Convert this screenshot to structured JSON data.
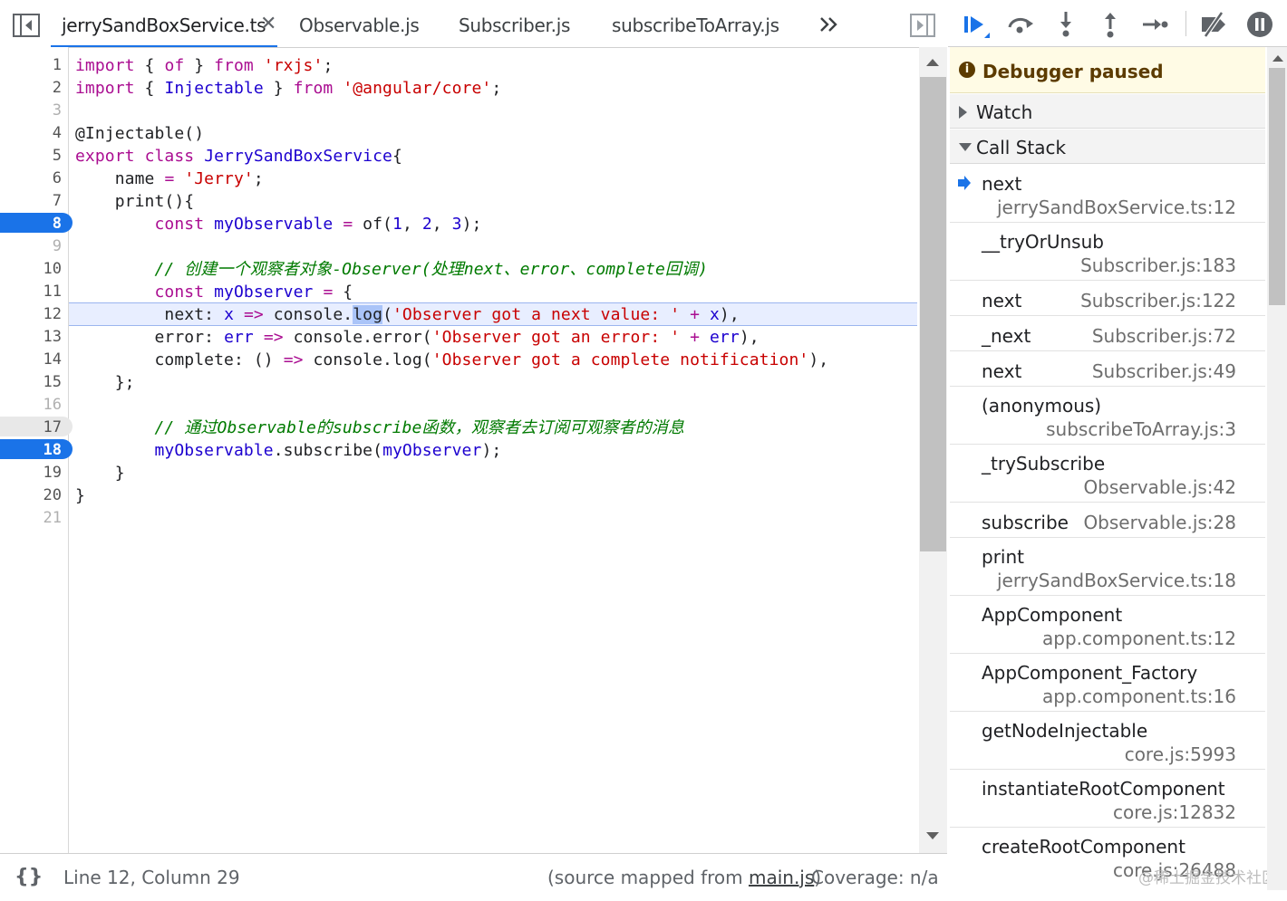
{
  "editor": {
    "tabs": [
      {
        "label": "jerrySandBoxService.ts",
        "active": true,
        "closable": true
      },
      {
        "label": "Observable.js"
      },
      {
        "label": "Subscriber.js"
      },
      {
        "label": "subscribeToArray.js"
      }
    ],
    "more_tabs_icon": "chevrons-right-icon",
    "nav_left_icon": "toggle-navigator-icon",
    "nav_right_icon": "toggle-debugger-icon",
    "gutter": {
      "line_numbers": [
        "1",
        "2",
        "3",
        "4",
        "5",
        "6",
        "7",
        "8",
        "9",
        "10",
        "11",
        "12",
        "13",
        "14",
        "15",
        "16",
        "17",
        "18",
        "19",
        "20",
        "21"
      ],
      "breakpoints": [
        "8",
        "18"
      ],
      "conditional_breakpoint": "17",
      "current_line": "12"
    },
    "code": {
      "l1": {
        "kw1": "import",
        "p1": " { ",
        "kw2": "of",
        "p2": " } ",
        "kw3": "from",
        "p3": " ",
        "s": "'rxjs'",
        "p4": ";"
      },
      "l2": {
        "kw1": "import",
        "p1": " { ",
        "v": "Injectable",
        "p2": " } ",
        "kw3": "from",
        "p3": " ",
        "s": "'@angular/core'",
        "p4": ";"
      },
      "l4": "@Injectable()",
      "l5": {
        "kw1": "export",
        "p1": " ",
        "kw2": "class",
        "p2": " ",
        "v": "JerrySandBoxService",
        "p3": "{"
      },
      "l6": {
        "p1": "    name ",
        "op": "=",
        "p2": " ",
        "s": "'Jerry'",
        "p3": ";"
      },
      "l7": "    print(){",
      "l8": {
        "p0": "        ",
        "kw": "const",
        "p1": " ",
        "v": "myObservable",
        "p2": " ",
        "op": "=",
        "p3": " of(",
        "n1": "1",
        "c1": ", ",
        "n2": "2",
        "c2": ", ",
        "n3": "3",
        "p4": ");"
      },
      "l10": "        // 创建一个观察者对象-Observer(处理next、error、complete回调)",
      "l11": {
        "p0": "        ",
        "kw": "const",
        "p1": " ",
        "v": "myObserver",
        "p2": " ",
        "op": "=",
        "p3": " {"
      },
      "l12": {
        "p0": "         next: ",
        "v": "x",
        "p1": " ",
        "op": "=>",
        "p2": " console.",
        "sel": "log",
        "p3": "(",
        "s": "'Observer got a next value: '",
        "p4": " ",
        "op2": "+",
        "p5": " ",
        "v2": "x",
        "p6": "),"
      },
      "l13": {
        "p0": "        error: ",
        "v": "err",
        "p1": " ",
        "op": "=>",
        "p2": " console.error(",
        "s": "'Observer got an error: '",
        "p3": " ",
        "op2": "+",
        "p4": " ",
        "v2": "err",
        "p5": "),"
      },
      "l14": {
        "p0": "        complete: () ",
        "op": "=>",
        "p1": " console.log(",
        "s": "'Observer got a complete notification'",
        "p2": "),"
      },
      "l15": "    };",
      "l17": "        // 通过Observable的subscribe函数，观察者去订阅可观察者的消息",
      "l18": {
        "p0": "        ",
        "v": "myObservable",
        "p1": ".subscribe(",
        "v2": "myObserver",
        "p2": ");"
      },
      "l19": "    }",
      "l20": "}"
    }
  },
  "statusbar": {
    "format_icon": "{}",
    "position": "Line 12, Column 29",
    "mapped_prefix": "(source mapped from ",
    "mapped_link": "main.js",
    "mapped_suffix": ")",
    "coverage": "Coverage: n/a"
  },
  "debugger": {
    "toolbar_icons": [
      "resume-icon",
      "step-over-icon",
      "step-into-icon",
      "step-out-icon",
      "step-icon",
      "deactivate-breakpoints-icon",
      "pause-on-exceptions-icon"
    ],
    "status_title": "Debugger paused",
    "sections": {
      "watch": "Watch",
      "call_stack": "Call Stack"
    },
    "call_stack": [
      {
        "fn": "next",
        "loc": "jerrySandBoxService.ts:12",
        "current": true
      },
      {
        "fn": "__tryOrUnsub",
        "loc": "Subscriber.js:183"
      },
      {
        "fn": "next",
        "loc": "Subscriber.js:122"
      },
      {
        "fn": "_next",
        "loc": "Subscriber.js:72"
      },
      {
        "fn": "next",
        "loc": "Subscriber.js:49"
      },
      {
        "fn": "(anonymous)",
        "loc": "subscribeToArray.js:3"
      },
      {
        "fn": "_trySubscribe",
        "loc": "Observable.js:42"
      },
      {
        "fn": "subscribe",
        "loc": "Observable.js:28"
      },
      {
        "fn": "print",
        "loc": "jerrySandBoxService.ts:18"
      },
      {
        "fn": "AppComponent",
        "loc": "app.component.ts:12"
      },
      {
        "fn": "AppComponent_Factory",
        "loc": "app.component.ts:16"
      },
      {
        "fn": "getNodeInjectable",
        "loc": "core.js:5993"
      },
      {
        "fn": "instantiateRootComponent",
        "loc": "core.js:12832"
      },
      {
        "fn": "createRootComponent",
        "loc": "core.js:26488"
      }
    ],
    "watermark": "@稀土掘金技术社区"
  },
  "colors": {
    "accent": "#1a73e8",
    "keyword": "#aa0d91",
    "string": "#c80000",
    "variable": "#1c00cf",
    "comment": "#007a00",
    "paused_bg": "#fffbe5"
  }
}
